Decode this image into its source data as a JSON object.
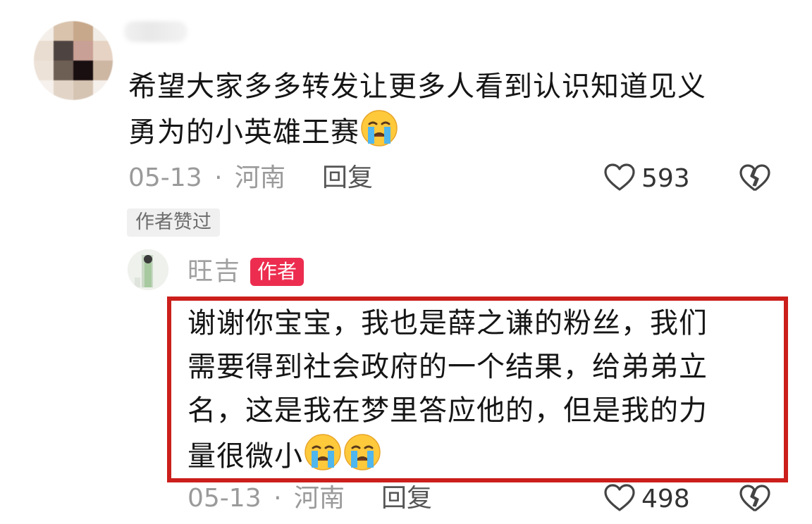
{
  "comment": {
    "text": "希望大家多多转发让更多人看到认识知道见义勇为的小英雄王赛",
    "line1": "希望大家多多转发让更多人看到认识知道见义",
    "line2": "勇为的小英雄王赛",
    "emoji": "crying-face-icon",
    "date": "05-13",
    "separator": "·",
    "location": "河南",
    "reply_label": "回复",
    "likes": "593",
    "liked_by_author_label": "作者赞过"
  },
  "reply": {
    "author": "旺吉",
    "author_badge": "作者",
    "line1": "谢谢你宝宝，我也是薛之谦的粉丝，我们",
    "line2": "需要得到社会政府的一个结果，给弟弟立",
    "line3": "名，这是我在梦里答应他的，但是我的力",
    "line4": "量很微小",
    "emoji": "crying-face-icon",
    "date": "05-13",
    "separator": "·",
    "location": "河南",
    "reply_label": "回复",
    "likes": "498"
  },
  "colors": {
    "highlight_border": "#cb1f1b",
    "author_badge_bg": "#ec2d4f",
    "meta_text": "#9a9a9a"
  }
}
